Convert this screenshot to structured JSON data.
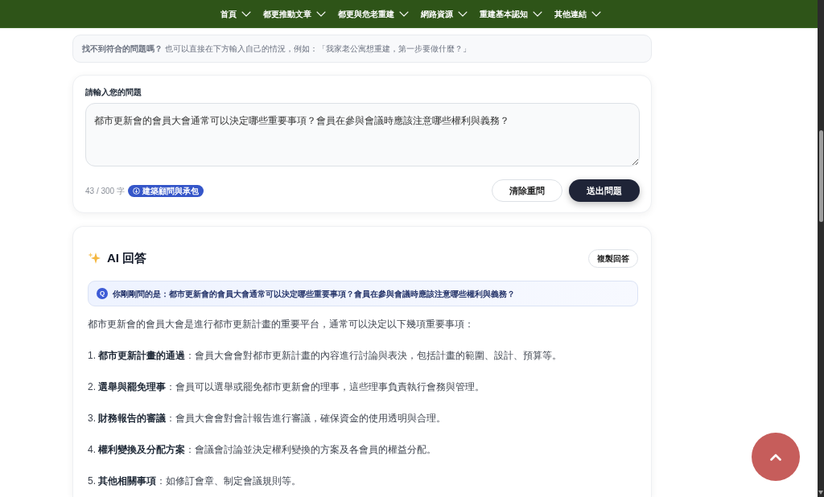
{
  "nav": {
    "items": [
      {
        "label": "首頁"
      },
      {
        "label": "都更推動文章"
      },
      {
        "label": "都更與危老重建"
      },
      {
        "label": "網路資源"
      },
      {
        "label": "重建基本認知"
      },
      {
        "label": "其他連結"
      }
    ]
  },
  "hint": {
    "text": "**找不到符合的問題嗎？** 也可以直接在下方輸入自己的情況，例如：「我家老公寓想重建，第一步要做什麼？」"
  },
  "question_form": {
    "label": "請輸入您的問題",
    "value": "都市更新會的會員大會通常可以決定哪些重要事項？會員在參與會議時應該注意哪些權利與義務？",
    "counter": "43 / 300 字",
    "tag": "建築顧問與承包",
    "buttons": [
      {
        "label": "清除重問",
        "kind": "secondary"
      },
      {
        "label": "送出問題",
        "kind": "primary"
      }
    ]
  },
  "answer": {
    "title": "AI 回答",
    "copy_button": "複製回答",
    "q_badge": "Q",
    "asked": "你剛剛問的是：都市更新會的會員大會通常可以決定哪些重要事項？會員在參與會議時應該注意哪些權利與義務？",
    "paragraphs": [
      "都市更新會的會員大會是進行都市更新計畫的重要平台，通常可以決定以下幾項重要事項：",
      "1. **都市更新計畫的通過**：會員大會會對都市更新計畫的內容進行討論與表決，包括計畫的範圍、設計、預算等。",
      "2. **選舉與罷免理事**：會員可以選舉或罷免都市更新會的理事，這些理事負責執行會務與管理。",
      "3. **財務報告的審議**：會員大會會對會計報告進行審議，確保資金的使用透明與合理。",
      "4. **權利變換及分配方案**：會議會討論並決定權利變換的方案及各會員的權益分配。",
      "5. **其他相關事項**：如修訂會章、制定會議規則等。"
    ]
  }
}
